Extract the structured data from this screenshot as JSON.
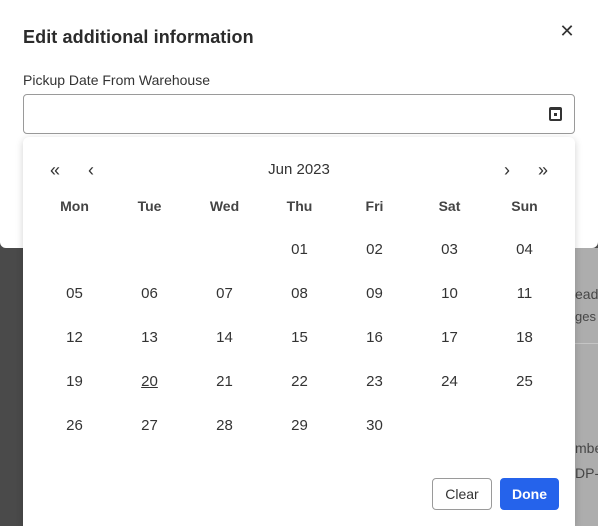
{
  "background": {
    "fragments": [
      "ead",
      "ges",
      "mbe",
      "DP-"
    ]
  },
  "modal": {
    "title": "Edit additional information",
    "close_icon": "close-icon",
    "field_label": "Pickup Date From Warehouse",
    "date_value": "",
    "calendar_icon": "calendar-icon"
  },
  "calendar": {
    "month_label": "Jun 2023",
    "nav": {
      "prev_year": "«",
      "prev_month": "‹",
      "next_month": "›",
      "next_year": "»"
    },
    "weekdays": [
      "Mon",
      "Tue",
      "Wed",
      "Thu",
      "Fri",
      "Sat",
      "Sun"
    ],
    "weeks": [
      [
        "",
        "",
        "",
        "01",
        "02",
        "03",
        "04"
      ],
      [
        "05",
        "06",
        "07",
        "08",
        "09",
        "10",
        "11"
      ],
      [
        "12",
        "13",
        "14",
        "15",
        "16",
        "17",
        "18"
      ],
      [
        "19",
        "20",
        "21",
        "22",
        "23",
        "24",
        "25"
      ],
      [
        "26",
        "27",
        "28",
        "29",
        "30",
        "",
        ""
      ]
    ],
    "today": "20",
    "clear_label": "Clear",
    "done_label": "Done",
    "accent_color": "#2563eb"
  }
}
